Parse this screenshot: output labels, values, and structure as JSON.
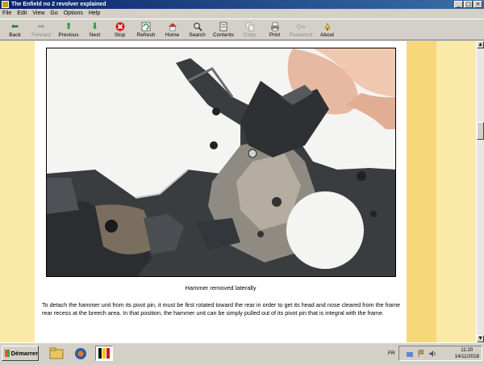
{
  "window": {
    "title": "The Enfield no 2 revolver explained",
    "buttons": [
      "_",
      "□",
      "×"
    ]
  },
  "menu": [
    "File",
    "Edit",
    "View",
    "Go",
    "Options",
    "Help"
  ],
  "toolbar": [
    {
      "label": "Back",
      "icon": "back-arrow-icon",
      "enabled": true
    },
    {
      "label": "Forward",
      "icon": "forward-arrow-icon",
      "enabled": false
    },
    {
      "label": "Previous",
      "icon": "up-arrow-icon",
      "enabled": true
    },
    {
      "label": "Next",
      "icon": "down-arrow-icon",
      "enabled": true
    },
    {
      "label": "Stop",
      "icon": "stop-icon",
      "enabled": true
    },
    {
      "label": "Refresh",
      "icon": "refresh-icon",
      "enabled": true
    },
    {
      "label": "Home",
      "icon": "home-icon",
      "enabled": true
    },
    {
      "label": "Search",
      "icon": "search-icon",
      "enabled": true
    },
    {
      "label": "Contents",
      "icon": "contents-icon",
      "enabled": true
    },
    {
      "label": "Copy",
      "icon": "copy-icon",
      "enabled": false
    },
    {
      "label": "Print",
      "icon": "print-icon",
      "enabled": true
    },
    {
      "label": "Password",
      "icon": "key-icon",
      "enabled": false
    },
    {
      "label": "About",
      "icon": "about-icon",
      "enabled": true
    }
  ],
  "content": {
    "caption": "Hammer removed laterally",
    "paragraph": "To detach the hammer unit from its pivot pin, it must be first rotated toward the rear in order to get its head and nose cleared from the frame rear recess at the breech area. In that position, the hammer unit can be simply pulled out of its pivot pin that is integral with the frame."
  },
  "taskbar": {
    "start_label": "Démarrer",
    "language": "FR",
    "time": "11:20",
    "date": "14/11/2018"
  },
  "colors": {
    "page_background": "#fbe9a8",
    "accent_band": "#f6d77a",
    "titlebar": "#0a246a"
  }
}
